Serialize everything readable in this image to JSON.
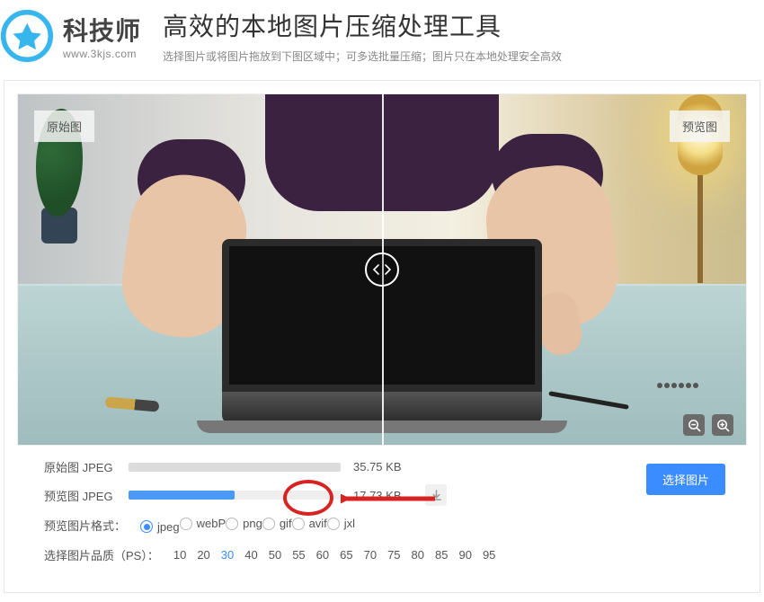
{
  "logo": {
    "name": "科技师",
    "url": "www.3kjs.com"
  },
  "header": {
    "title": "高效的本地图片压缩处理工具",
    "subtitle": "选择图片或将图片拖放到下图区域中；可多选批量压缩；图片只在本地处理安全高效"
  },
  "preview": {
    "label_left": "原始图",
    "label_right": "预览图"
  },
  "stats": {
    "orig": {
      "label": "原始图 JPEG",
      "size": "35.75 KB",
      "pct": 100
    },
    "prev": {
      "label": "预览图 JPEG",
      "size": "17.73 KB",
      "pct": 50
    }
  },
  "actions": {
    "select_image": "选择图片"
  },
  "format": {
    "label": "预览图片格式：",
    "options": [
      "jpeg",
      "webP",
      "png",
      "gif",
      "avif",
      "jxl"
    ],
    "selected": "jpeg"
  },
  "quality": {
    "label": "选择图片品质（PS）：",
    "options": [
      10,
      20,
      30,
      40,
      50,
      55,
      60,
      65,
      70,
      75,
      80,
      85,
      90,
      95
    ],
    "selected": 30
  }
}
